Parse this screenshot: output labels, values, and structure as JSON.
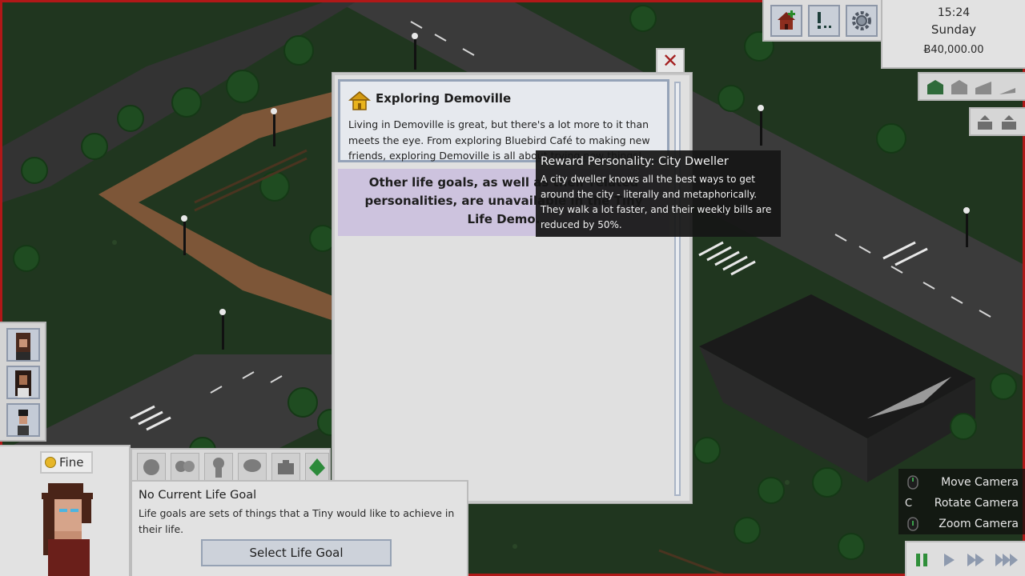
{
  "hud": {
    "time": "15:24",
    "day": "Sunday",
    "money": "Ƀ40,000.00",
    "buttons": [
      {
        "name": "build-house-icon"
      },
      {
        "name": "goals-list-icon"
      },
      {
        "name": "settings-gear-icon"
      }
    ],
    "camera_angle_icons": [
      "camera-angle-1-icon",
      "camera-angle-2-icon",
      "camera-angle-3-icon",
      "camera-angle-4-icon"
    ],
    "floor_icons": [
      "floor-down-icon",
      "floor-up-icon"
    ]
  },
  "dialog": {
    "close_symbol": "✕",
    "goal": {
      "icon": "house-gold-icon",
      "title": "Exploring Demoville",
      "description": "Living in Demoville is great, but there's a lot more to it than meets the eye. From exploring Bluebird Café to making new friends, exploring Demoville is all about trying new things!"
    },
    "demo_note": "Other life goals, as well as their related personalities, are unavailable in the Tiny Life Demo."
  },
  "tooltip": {
    "title": "Reward Personality: City Dweller",
    "description": "A city dweller knows all the best ways to get around the city - literally and metaphorically. They walk a lot faster, and their weekly bills are reduced by 50%."
  },
  "tiny": {
    "mood_label": "Fine",
    "mood_icon": "smiley-icon",
    "tabs": [
      "needs-tab-icon",
      "relationships-tab-icon",
      "personality-tab-icon",
      "thoughts-tab-icon",
      "job-tab-icon",
      "life-goal-tab-icon"
    ],
    "life_goal_title": "No Current Life Goal",
    "life_goal_description": "Life goals are sets of things that a Tiny would like to achieve in their life.",
    "select_button": "Select Life Goal"
  },
  "camera_hints": [
    {
      "key": "",
      "label": "Move Camera",
      "icon": "mouse-icon"
    },
    {
      "key": "C",
      "label": "Rotate Camera",
      "icon": ""
    },
    {
      "key": "",
      "label": "Zoom Camera",
      "icon": "scroll-wheel-icon"
    }
  ],
  "speed_controls": [
    "pause-icon",
    "play-speed-1-icon",
    "play-speed-2-icon",
    "play-speed-3-icon"
  ],
  "colors": {
    "frame_border": "#b01818",
    "dialog_bg": "#e0e0e0",
    "goal_card_border": "#95a3b8",
    "demo_note_bg": "#cdc3de",
    "tooltip_bg": "#161616"
  }
}
